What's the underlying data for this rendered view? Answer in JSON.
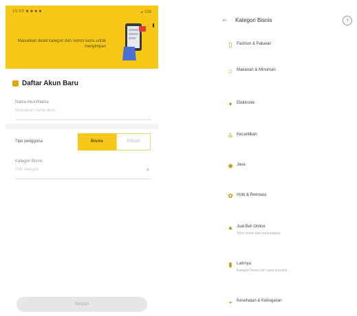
{
  "left_screen": {
    "status": {
      "time": "10:00 ■ ■ ■ ■",
      "right": "⊿ 100"
    },
    "hero_text": "Masukkan detail kategori dan nomor kartu untuk menyimpan",
    "form_title": "Daftar Akun Baru",
    "field_name": {
      "label": "Nama Akun/Nama",
      "placeholder": "Masukkan nama akun"
    },
    "type_label": "Tipe pengguna",
    "type_options": [
      "Bisnis",
      "Pribadi"
    ],
    "category": {
      "label": "Kategori Bisnis",
      "value": "Pilih kategori",
      "chevron": "›"
    },
    "submit": "Simpan"
  },
  "right_screen": {
    "back": "←",
    "title": "Kategori Bisnis",
    "help": "?",
    "categories": [
      {
        "icon": "▯",
        "label": "Fashion & Pakaian",
        "sub": ""
      },
      {
        "icon": "⌂",
        "label": "Makanan & Minuman",
        "sub": ""
      },
      {
        "icon": "♦",
        "label": "Elektronik",
        "sub": ""
      },
      {
        "icon": "♙",
        "label": "Kecantikan",
        "sub": ""
      },
      {
        "icon": "◉",
        "label": "Jasa",
        "sub": ""
      },
      {
        "icon": "✿",
        "label": "Hobi & Rekreasi",
        "sub": ""
      },
      {
        "icon": "▲",
        "label": "Jual Beli Online",
        "sub": "Toko online dan marketplace"
      },
      {
        "icon": "▮",
        "label": "Lainnya",
        "sub": "Kategori bisnis lain yang tersedia"
      },
      {
        "icon": "◒",
        "label": "Kesehatan & Kebugaran",
        "sub": ""
      }
    ]
  },
  "colors": {
    "accent": "#f7c818",
    "accent_dark": "#e0a800"
  }
}
